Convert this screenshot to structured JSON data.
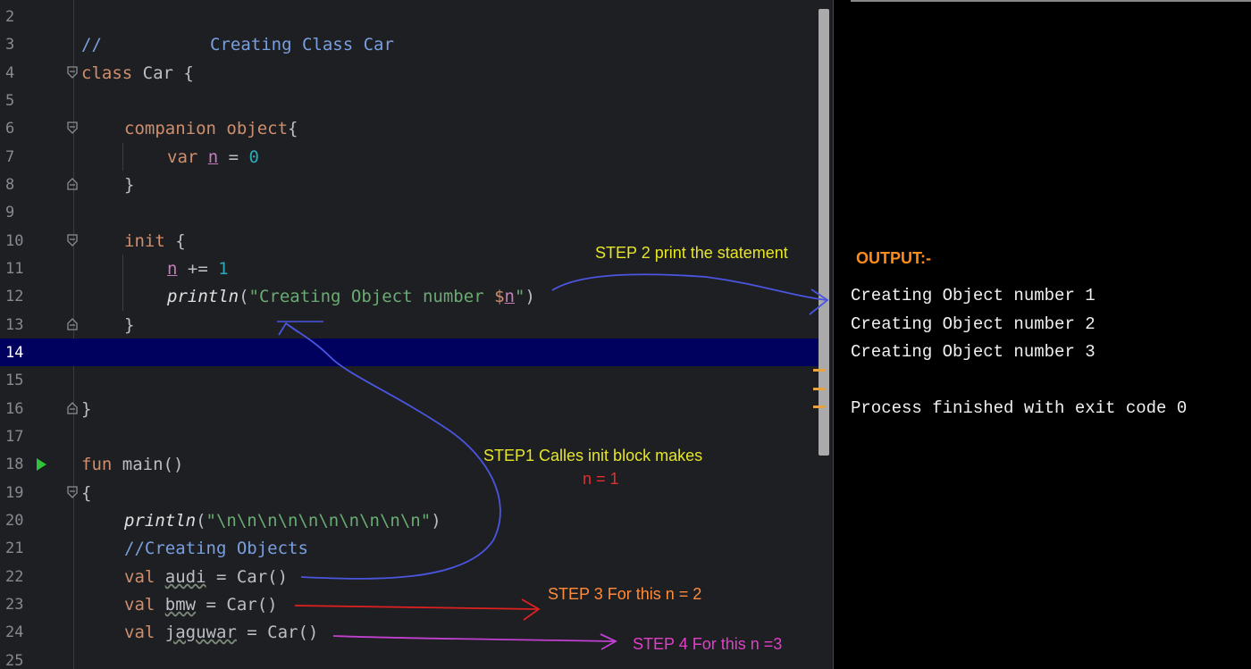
{
  "editor": {
    "lines": [
      {
        "num": "2"
      },
      {
        "num": "3"
      },
      {
        "num": "4"
      },
      {
        "num": "5"
      },
      {
        "num": "6"
      },
      {
        "num": "7"
      },
      {
        "num": "8"
      },
      {
        "num": "9"
      },
      {
        "num": "10"
      },
      {
        "num": "11"
      },
      {
        "num": "12"
      },
      {
        "num": "13"
      },
      {
        "num": "14"
      },
      {
        "num": "15"
      },
      {
        "num": "16"
      },
      {
        "num": "17"
      },
      {
        "num": "18"
      },
      {
        "num": "19"
      },
      {
        "num": "20"
      },
      {
        "num": "21"
      },
      {
        "num": "22"
      },
      {
        "num": "23"
      },
      {
        "num": "24"
      },
      {
        "num": "25"
      }
    ],
    "tokens": {
      "comment_slashes": "//",
      "comment_class": "Creating Class Car",
      "kw_class": "class",
      "class_decl": " Car {",
      "kw_companion": "companion object",
      "brace_open": "{",
      "kw_var": "var ",
      "var_n": "n",
      "assign_eq": " = ",
      "zero": "0",
      "brace_close": "}",
      "kw_init": "init",
      "init_brace": " {",
      "plus_eq": " += ",
      "one": "1",
      "println": "println",
      "paren_open": "(",
      "str_object": "\"Creating Object number ",
      "dollar": "$",
      "str_end": "\"",
      "paren_close": ")",
      "kw_fun": "fun",
      "main_sig": " main()",
      "main_brace": "{",
      "str_newlines": "\"\\n\\n\\n\\n\\n\\n\\n\\n\\n\\n\"",
      "comment_objects": "//Creating Objects",
      "kw_val": "val ",
      "audi": "audi",
      "bmw": "bmw",
      "jaguwar": "jaguwar",
      "car_call": " = Car()"
    }
  },
  "console": {
    "output_label": "OUTPUT:-",
    "lines": [
      "Creating Object number 1",
      "Creating Object number 2",
      "Creating Object number 3",
      "Process finished with exit code 0"
    ]
  },
  "annotations": {
    "step2": "STEP 2 print the statement",
    "step1": "STEP1  Calles init block makes",
    "step1_n": "n = 1",
    "step3": "STEP 3 For this n = 2",
    "step4": "STEP 4 For this n =3"
  },
  "colors": {
    "output_label": "#ff8c1a",
    "step_yellow": "#e6e629",
    "step_red": "#e03030",
    "step_orange": "#ff8c3c",
    "step_magenta": "#e040c8",
    "arrow_blue": "#4a55e0",
    "arrow_red": "#e02020",
    "arrow_purple": "#c040d0",
    "current_line": "#00005f"
  }
}
